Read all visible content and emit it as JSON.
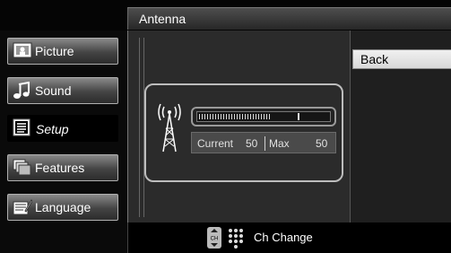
{
  "screen": {
    "title": "Antenna"
  },
  "menu": {
    "items": [
      {
        "label": "Picture",
        "icon": "picture-icon"
      },
      {
        "label": "Sound",
        "icon": "sound-icon"
      },
      {
        "label": "Setup",
        "icon": "setup-icon"
      },
      {
        "label": "Features",
        "icon": "features-icon"
      },
      {
        "label": "Language",
        "icon": "language-icon"
      }
    ],
    "selected": "Setup"
  },
  "signal": {
    "current_label": "Current",
    "current_value": "50",
    "max_label": "Max",
    "max_value": "50",
    "meter_fraction": 0.78
  },
  "actions": {
    "back_label": "Back"
  },
  "footer": {
    "hint": "Ch Change"
  },
  "colors": {
    "highlight": "#f0f0f0",
    "panel": "#2b2b2b",
    "menu_gradient_top": "#8a8a8a"
  }
}
